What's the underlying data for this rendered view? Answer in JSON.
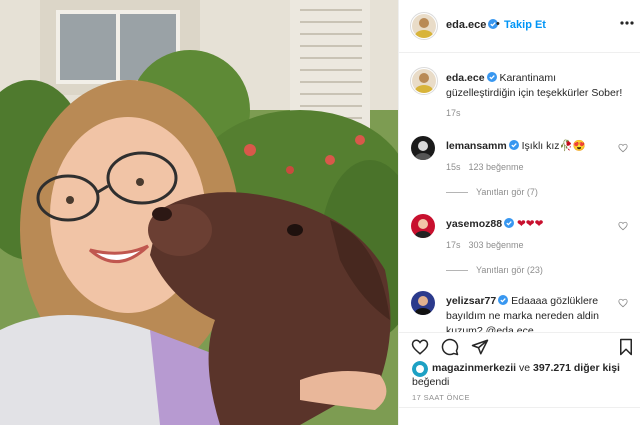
{
  "post": {
    "author": "eda.ece",
    "follow_label": "Takip Et",
    "separator": "•",
    "more_label": "•••"
  },
  "caption": {
    "username": "eda.ece",
    "text": "Karantinamı güzelleştirdiğin için teşekkürler Sober!",
    "time": "17s"
  },
  "comments": [
    {
      "username": "lemansamm",
      "text": "Işıklı kız🥀😍",
      "time": "15s",
      "likes": "123 beğenme",
      "replies": "Yanıtları gör (7)",
      "avatar_color": "#1a1a1a"
    },
    {
      "username": "yasemoz88",
      "text": "❤❤❤",
      "time": "17s",
      "likes": "303 beğenme",
      "replies": "Yanıtları gör (23)",
      "avatar_color": "#c8102e"
    },
    {
      "username": "yelizsar77",
      "text": "Edaaaa gözlüklere bayıldım ne marka nereden aldin kuzum? @eda.ece",
      "avatar_color": "#2b3a8c"
    }
  ],
  "likes": {
    "first_user": "magazinmerkezii",
    "connector": " ve ",
    "others": "397.271 diğer kişi",
    "suffix": "beğendi"
  },
  "posted_ago": "17 SAAT ÖNCE",
  "icons": [
    "verified-badge-icon",
    "more-options-icon",
    "heart-icon",
    "comment-icon",
    "share-icon",
    "bookmark-icon"
  ],
  "colors": {
    "follow_blue": "#0095f6",
    "verified_blue": "#3897f0",
    "muted_text": "#8e8e8e",
    "border": "#efefef"
  }
}
